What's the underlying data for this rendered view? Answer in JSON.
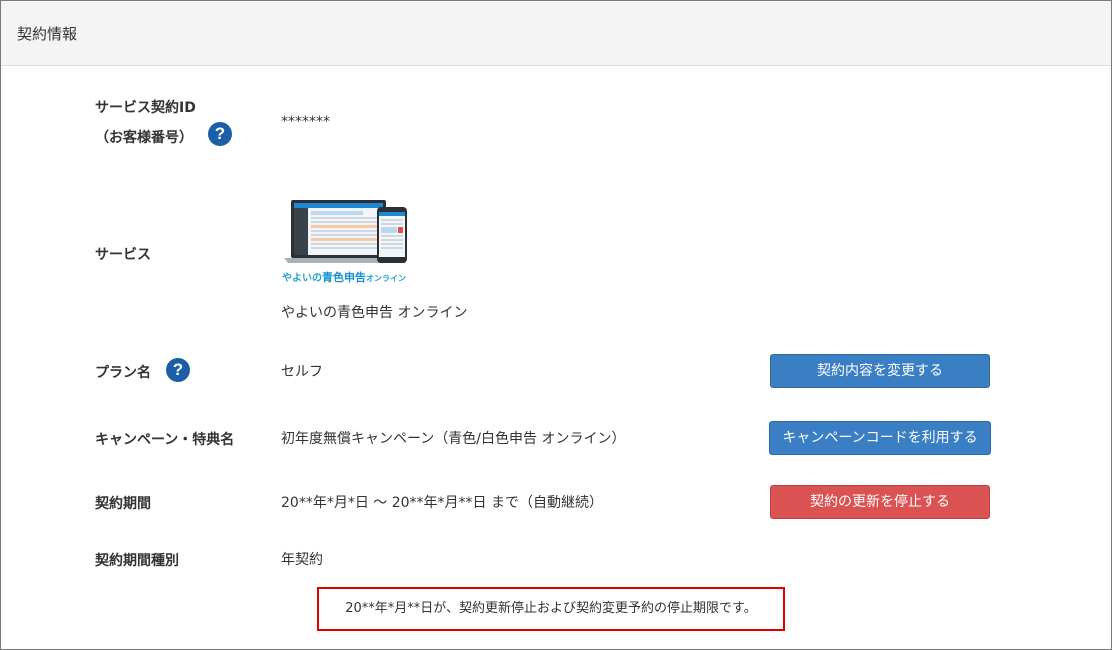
{
  "panel": {
    "title": "契約情報"
  },
  "rows": {
    "service_id": {
      "label_line1": "サービス契約ID",
      "label_line2": "（お客様番号）",
      "value": "*******"
    },
    "service": {
      "label": "サービス",
      "brand_small": "やよいの",
      "brand_big": "青色申告",
      "brand_suffix": "オンライン",
      "value": "やよいの青色申告 オンライン"
    },
    "plan": {
      "label": "プラン名",
      "value": "セルフ"
    },
    "campaign": {
      "label": "キャンペーン・特典名",
      "value": "初年度無償キャンペーン（青色/白色申告 オンライン）"
    },
    "period": {
      "label": "契約期間",
      "value": "20**年*月*日 ～ 20**年*月**日 まで（自動継続）"
    },
    "period_type": {
      "label": "契約期間種別",
      "value": "年契約"
    }
  },
  "buttons": {
    "change_contract": "契約内容を変更する",
    "use_campaign_code": "キャンペーンコードを利用する",
    "stop_renewal": "契約の更新を停止する"
  },
  "help_glyph": "?",
  "notice": "20**年*月**日が、契約更新停止および契約変更予約の停止期限です。",
  "colors": {
    "primary_button": "#3a7fc4",
    "danger_button": "#da5252",
    "help_icon": "#1b5fa8",
    "notice_border": "#e00000",
    "brand": "#1ea3d6"
  }
}
